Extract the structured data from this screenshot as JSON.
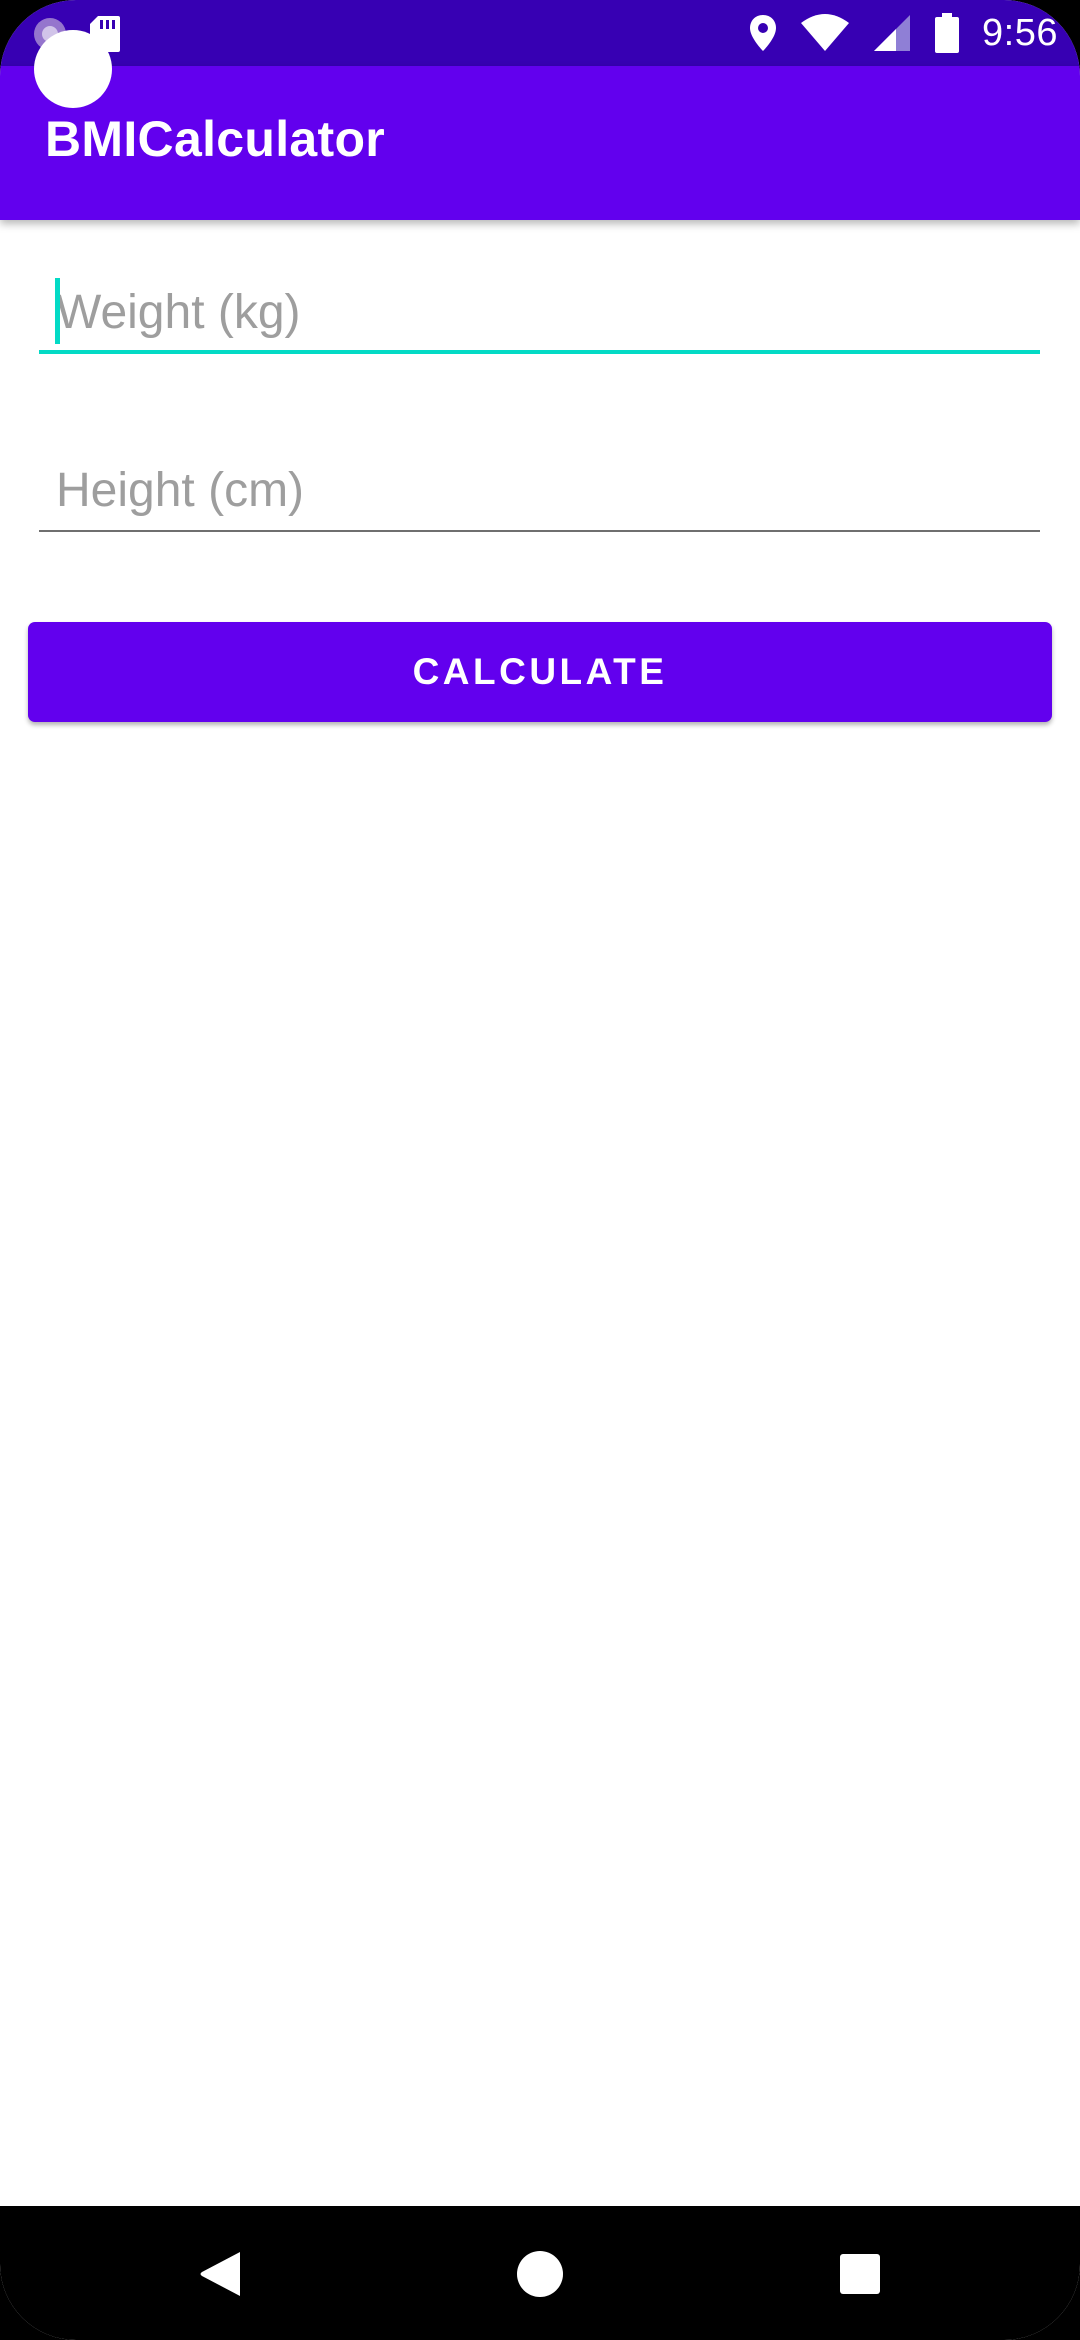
{
  "status_bar": {
    "time": "9:56",
    "left_icons": [
      "notification-app-icon",
      "sd-card-icon"
    ],
    "right_icons": [
      "location-icon",
      "wifi-icon",
      "cellular-signal-icon",
      "battery-icon"
    ]
  },
  "app_bar": {
    "title": "BMICalculator"
  },
  "form": {
    "weight": {
      "placeholder": "Weight (kg)",
      "value": ""
    },
    "height": {
      "placeholder": "Height (cm)",
      "value": ""
    },
    "calculate_label": "CALCULATE"
  },
  "nav_bar": {
    "buttons": [
      "back-icon",
      "home-icon",
      "recents-icon"
    ]
  },
  "colors": {
    "primary": "#6200ee",
    "primary_dark": "#3700b3",
    "accent": "#03dac5",
    "hint": "#9e9e9e"
  }
}
